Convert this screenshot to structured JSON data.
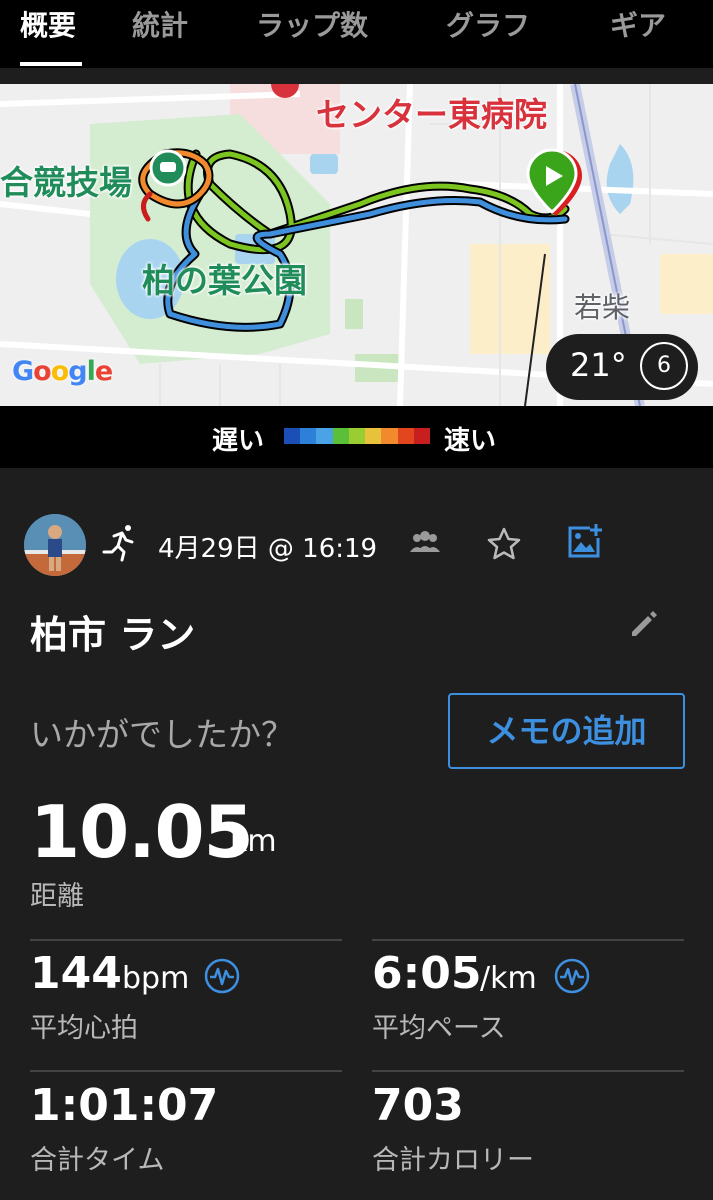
{
  "tabs": [
    "概要",
    "統計",
    "ラップ数",
    "グラフ",
    "ギア"
  ],
  "active_tab": 0,
  "map": {
    "labels": {
      "hospital": "センター東病院",
      "stadium": "合競技場",
      "park": "柏の葉公園",
      "area": "若柴"
    },
    "attribution": "Google",
    "weather": {
      "temperature": "21°",
      "wind": "6"
    }
  },
  "legend": {
    "slow": "遅い",
    "fast": "速い",
    "colors": [
      "#1b4fb5",
      "#2e7fd8",
      "#4aa3e6",
      "#5bbf3a",
      "#9acd32",
      "#e8c23a",
      "#f08a2c",
      "#e2461e",
      "#c81e1e"
    ]
  },
  "activity": {
    "date": "4月29日 @ 16:19",
    "title": "柏市 ラン",
    "prompt": "いかがでしたか？",
    "memo_button": "メモの追加"
  },
  "stats": {
    "distance": {
      "value": "10.05",
      "unit": "km",
      "label": "距離"
    },
    "heart_rate": {
      "value": "144",
      "unit": "bpm",
      "label": "平均心拍"
    },
    "pace": {
      "value": "6:05",
      "unit": "/km",
      "label": "平均ペース"
    },
    "time": {
      "value": "1:01:07",
      "label": "合計タイム"
    },
    "calories": {
      "value": "703",
      "label": "合計カロリー"
    }
  },
  "colors": {
    "accent_blue": "#3d8fe0",
    "background": "#1e1e1e"
  }
}
